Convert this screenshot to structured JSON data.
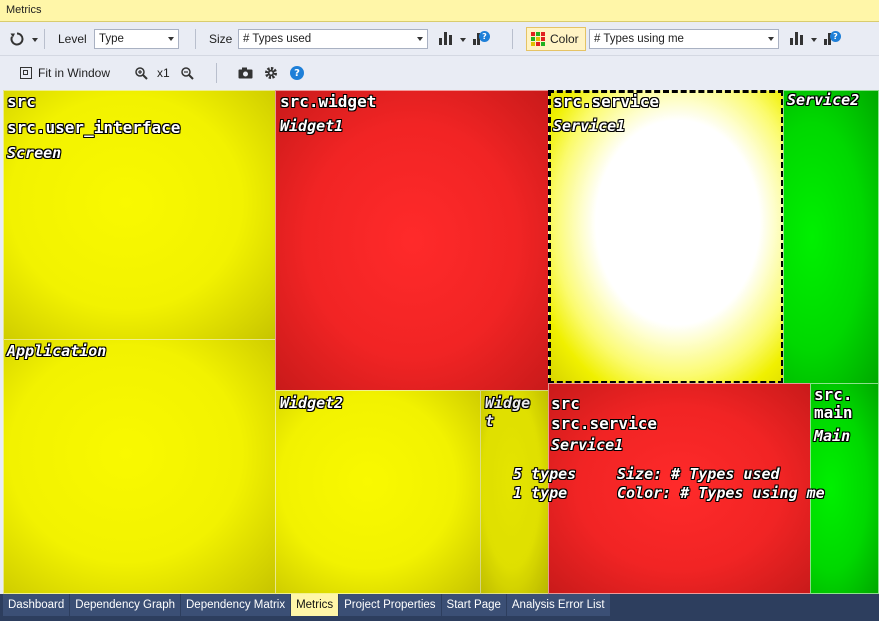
{
  "window": {
    "title": "Metrics"
  },
  "toolbar": {
    "level_label": "Level",
    "level_value": "Type",
    "size_label": "Size",
    "size_value": "# Types used",
    "color_label": "Color",
    "color_value": "# Types using me",
    "fit_label": "Fit in Window",
    "zoom_label": "x1"
  },
  "treemap": {
    "cells": {
      "screen": {
        "lines": [
          "src",
          "src.user_interface",
          "Screen"
        ]
      },
      "application": {
        "label": "Application"
      },
      "widget1": {
        "lines": [
          "src.widget",
          "Widget1"
        ]
      },
      "widget2": {
        "label": "Widget2"
      },
      "widget3": {
        "label": "Widge\nt"
      },
      "service1": {
        "lines": [
          "src.service",
          "Service1"
        ]
      },
      "service2": {
        "label": "Service2"
      },
      "main": {
        "lines": [
          "src.\nmain",
          "Main"
        ]
      }
    },
    "tooltip": {
      "path": [
        "src",
        "src.service",
        "Service1"
      ],
      "size_count": "5 types",
      "color_count": "1 type",
      "size_metric": "Size: # Types used",
      "color_metric": "Color: # Types using me"
    }
  },
  "tabs": [
    {
      "label": "Dashboard",
      "active": false
    },
    {
      "label": "Dependency Graph",
      "active": false
    },
    {
      "label": "Dependency Matrix",
      "active": false
    },
    {
      "label": "Metrics",
      "active": true
    },
    {
      "label": "Project Properties",
      "active": false
    },
    {
      "label": "Start Page",
      "active": false
    },
    {
      "label": "Analysis Error List",
      "active": false
    }
  ]
}
